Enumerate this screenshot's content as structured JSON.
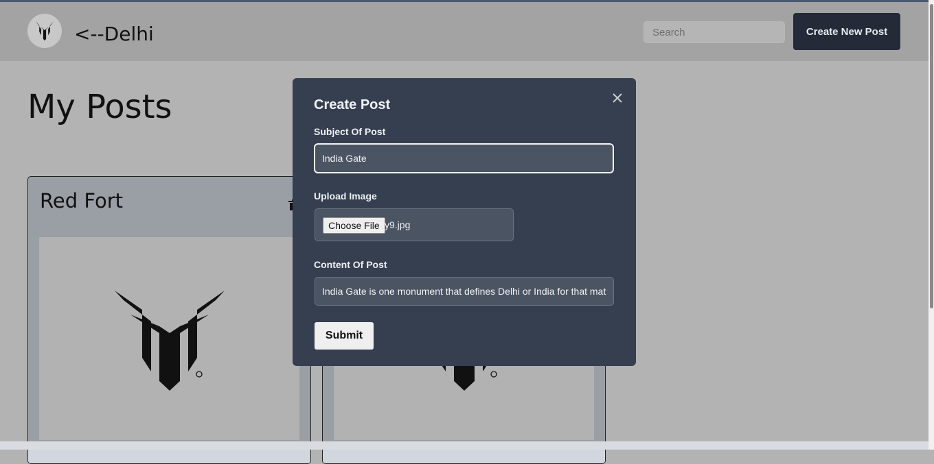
{
  "header": {
    "brand": "<--Delhi",
    "search_placeholder": "Search",
    "create_button": "Create New Post"
  },
  "page": {
    "title": "My Posts"
  },
  "posts": [
    {
      "title": "Red Fort"
    },
    {
      "title": ""
    }
  ],
  "modal": {
    "title": "Create Post",
    "subject_label": "Subject Of Post",
    "subject_value": "India Gate",
    "upload_label": "Upload Image",
    "choose_file_label": "Choose File",
    "file_name": "y9.jpg",
    "content_label": "Content Of Post",
    "content_value": "India Gate is one monument that defines Delhi or India for that matter",
    "submit_label": "Submit"
  },
  "colors": {
    "header_bg": "#a3a3a3",
    "page_bg": "#b3b3b3",
    "modal_bg": "#363f50",
    "primary_button": "#242a38"
  },
  "icons": [
    "logo-icon",
    "close-icon",
    "trash-icon"
  ]
}
